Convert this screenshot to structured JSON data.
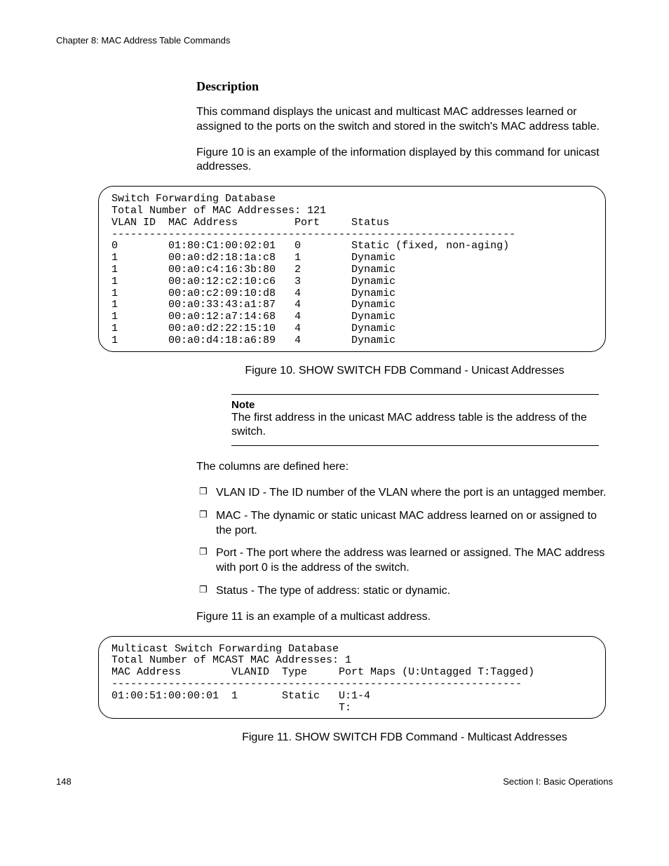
{
  "chapter_header": "Chapter 8: MAC Address Table Commands",
  "section_heading": "Description",
  "para1": "This command displays the unicast and multicast MAC addresses learned or assigned to the ports on the switch and stored in the switch's MAC address table.",
  "para2": "Figure 10 is an example of the information displayed by this command for unicast addresses.",
  "figure10": {
    "title_line": "Switch Forwarding Database",
    "total_line": "Total Number of MAC Addresses: 121",
    "header_line": "VLAN ID  MAC Address         Port     Status",
    "divider": "----------------------------------------------------------------",
    "rows": [
      "0        01:80:C1:00:02:01   0        Static (fixed, non-aging)",
      "1        00:a0:d2:18:1a:c8   1        Dynamic",
      "1        00:a0:c4:16:3b:80   2        Dynamic",
      "1        00:a0:12:c2:10:c6   3        Dynamic",
      "1        00:a0:c2:09:10:d8   4        Dynamic",
      "1        00:a0:33:43:a1:87   4        Dynamic",
      "1        00:a0:12:a7:14:68   4        Dynamic",
      "1        00:a0:d2:22:15:10   4        Dynamic",
      "1        00:a0:d4:18:a6:89   4        Dynamic"
    ],
    "caption": "Figure 10. SHOW SWITCH FDB Command - Unicast Addresses"
  },
  "note_label": "Note",
  "note_body": "The first address in the unicast MAC address table is the address of the switch.",
  "columns_intro": "The columns are defined here:",
  "column_defs": [
    "VLAN ID - The ID number of the VLAN where the port is an untagged member.",
    "MAC - The dynamic or static unicast MAC address learned on or assigned to the port.",
    "Port - The port where the address was learned or assigned. The MAC address with port 0 is the address of the switch.",
    "Status - The type of address: static or dynamic."
  ],
  "para3": "Figure 11 is an example of a multicast address.",
  "figure11": {
    "title_line": "Multicast Switch Forwarding Database",
    "total_line": "Total Number of MCAST MAC Addresses: 1",
    "header_line": "MAC Address        VLANID  Type     Port Maps (U:Untagged T:Tagged)",
    "divider": "-----------------------------------------------------------------",
    "row1": "01:00:51:00:00:01  1       Static   U:1-4",
    "row2": "                                    T:",
    "caption": "Figure 11. SHOW SWITCH FDB Command - Multicast Addresses"
  },
  "footer_page": "148",
  "footer_section": "Section I: Basic Operations"
}
